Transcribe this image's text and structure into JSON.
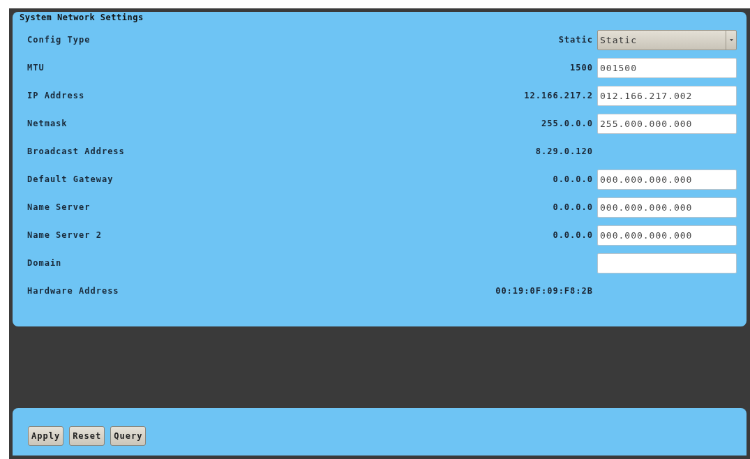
{
  "panel": {
    "title": "System Network Settings"
  },
  "rows": [
    {
      "label": "Config Type",
      "current": "Static",
      "control": {
        "kind": "select",
        "value": "Static"
      }
    },
    {
      "label": "MTU",
      "current": "1500",
      "control": {
        "kind": "input",
        "value": "001500"
      }
    },
    {
      "label": "IP Address",
      "current": "12.166.217.2",
      "control": {
        "kind": "input",
        "value": "012.166.217.002"
      }
    },
    {
      "label": "Netmask",
      "current": "255.0.0.0",
      "control": {
        "kind": "input",
        "value": "255.000.000.000"
      }
    },
    {
      "label": "Broadcast Address",
      "current": "8.29.0.120"
    },
    {
      "label": "Default Gateway",
      "current": "0.0.0.0",
      "control": {
        "kind": "input",
        "value": "000.000.000.000"
      }
    },
    {
      "label": "Name Server",
      "current": "0.0.0.0",
      "control": {
        "kind": "input",
        "value": "000.000.000.000"
      }
    },
    {
      "label": "Name Server 2",
      "current": "0.0.0.0",
      "control": {
        "kind": "input",
        "value": "000.000.000.000"
      }
    },
    {
      "label": "Domain",
      "control": {
        "kind": "input"
      }
    },
    {
      "label": "Hardware Address",
      "current": "00:19:0F:09:F8:2B"
    }
  ],
  "buttons": [
    "Apply",
    "Reset",
    "Query"
  ]
}
